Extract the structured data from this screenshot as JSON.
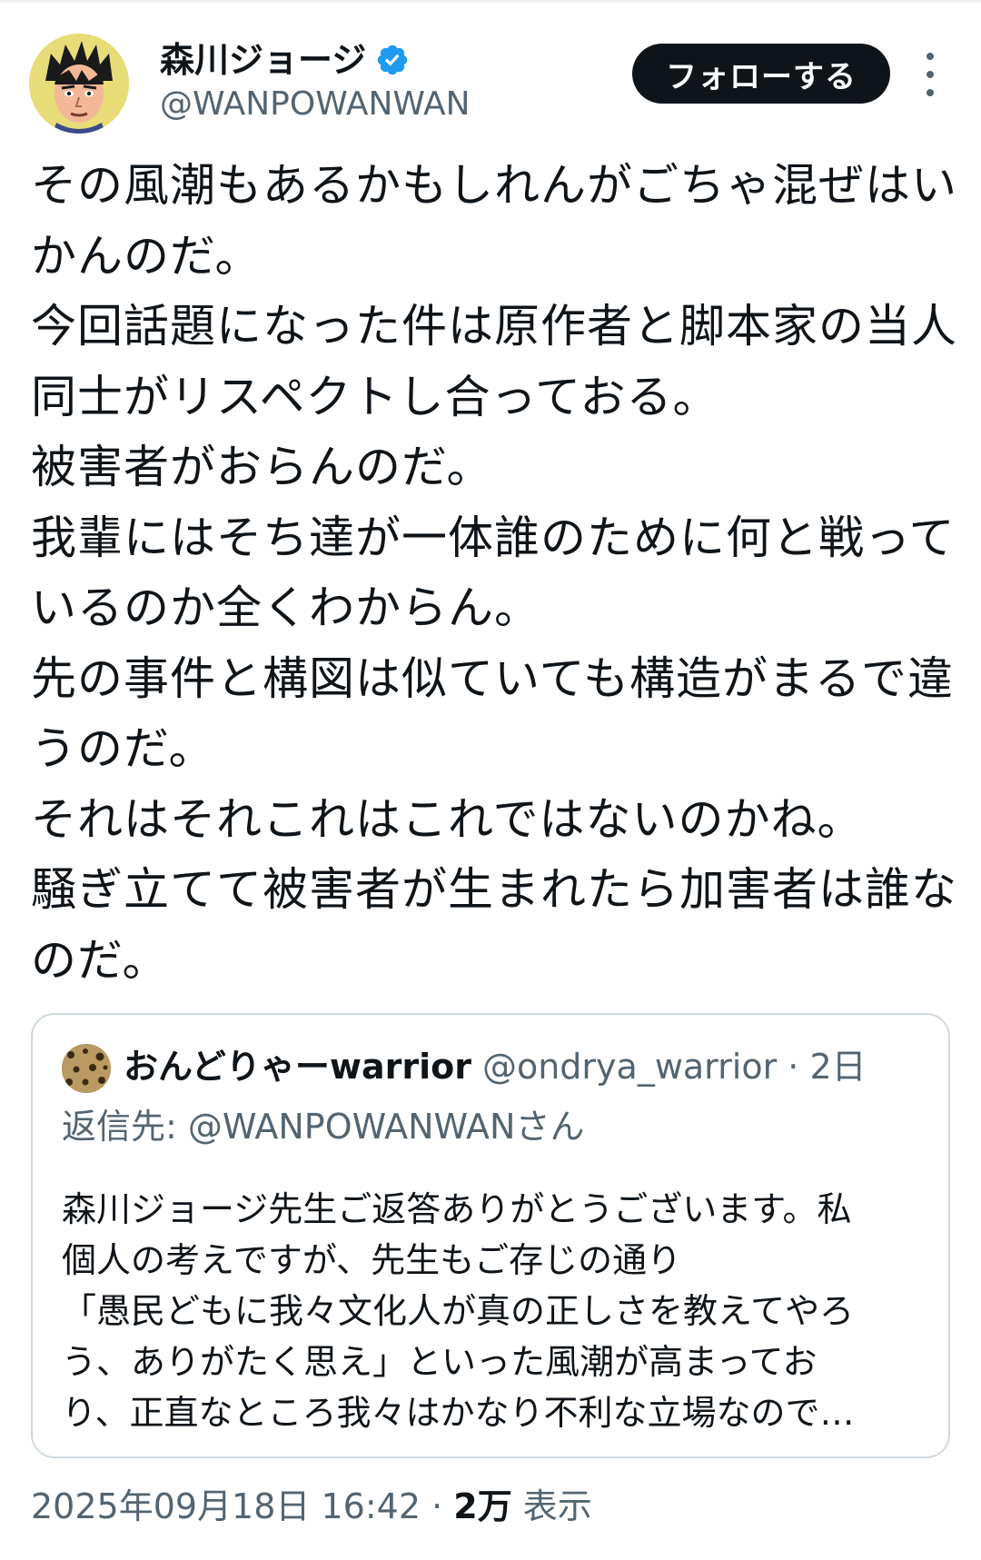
{
  "author": {
    "display_name": "森川ジョージ",
    "handle": "@WANPOWANWAN",
    "verified": true,
    "avatar_icon": "manga-boxer-avatar-icon"
  },
  "actions": {
    "follow_label": "フォローする",
    "more_icon": "more-dots-vertical-icon"
  },
  "tweet": {
    "lines": [
      "その風潮もあるかもしれんがごちゃ混ぜはい",
      "かんのだ。",
      "今回話題になった件は原作者と脚本家の当人",
      "同士がリスペクトし合っておる。",
      "被害者がおらんのだ。",
      "我輩にはそち達が一体誰のために何と戦って",
      "いるのか全くわからん。",
      "先の事件と構図は似ていても構造がまるで違",
      "うのだ。",
      "それはそれこれはこれではないのかね。",
      "騒ぎ立てて被害者が生まれたら加害者は誰な",
      "のだ。"
    ]
  },
  "quote": {
    "display_name": "おんどりゃーwarrior",
    "handle": "@ondrya_warrior",
    "separator": " · ",
    "date": "2日",
    "reply_to": "返信先: @WANPOWANWANさん",
    "lines": [
      "森川ジョージ先生ご返答ありがとうございます。私",
      "個人の考えですが、先生もご存じの通り",
      "「愚民どもに我々文化人が真の正しさを教えてやろ",
      "う、ありがたく思え」といった風潮が高まってお",
      "り、正直なところ我々はかなり不利な立場なので…"
    ]
  },
  "meta": {
    "timestamp": "2025年09月18日 16:42",
    "separator": " · ",
    "views_count": "2万",
    "views_label": " 表示"
  },
  "colors": {
    "text": "#0f1419",
    "secondary": "#536471",
    "verified_blue": "#1d9bf0",
    "border": "#cfd9de",
    "button_bg": "#0f1419"
  }
}
